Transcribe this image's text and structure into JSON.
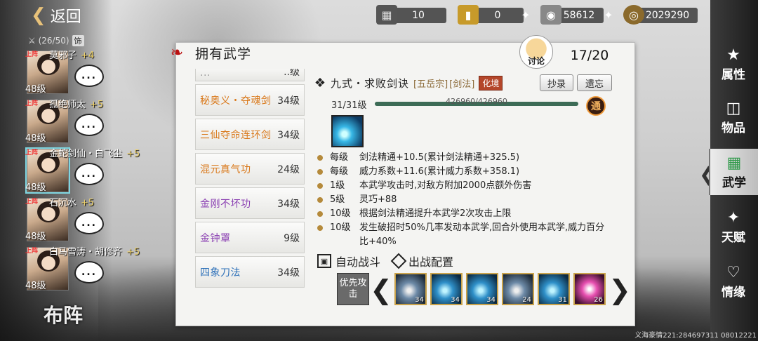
{
  "back_label": "返回",
  "team_count": "(26/50)",
  "team_badge": "饰",
  "heroes": [
    {
      "tag": "上阵",
      "name": "莫邪子",
      "plus": "+4",
      "level": "48级",
      "chat": "..."
    },
    {
      "tag": "上阵",
      "name": "孤绝师太",
      "plus": "+5",
      "level": "48级",
      "chat": "..."
    },
    {
      "tag": "上阵",
      "name": "金蛇剑仙・白飞尘",
      "plus": "+5",
      "level": "48级",
      "chat": "..."
    },
    {
      "tag": "上阵",
      "name": "石沉水",
      "plus": "+5",
      "level": "48级",
      "chat": "..."
    },
    {
      "tag": "上阵",
      "name": "白马雪涛・胡修齐",
      "plus": "+5",
      "level": "48级",
      "chat": "..."
    }
  ],
  "formation_label": "布阵",
  "currency": [
    {
      "icon": "cart-icon",
      "value": "10"
    },
    {
      "icon": "gold-bar-icon",
      "value": "0"
    },
    {
      "icon": "silver-ingot-icon",
      "value": "58612"
    },
    {
      "icon": "coin-icon",
      "value": "2029290"
    }
  ],
  "panel_title": "拥有武学",
  "discuss_label": "讨论",
  "counter": "17/20",
  "skills": [
    {
      "name": "...",
      "level": "..级",
      "color": "gray"
    },
    {
      "name": "秘奥义・夺魂剑",
      "level": "34级",
      "color": "orange"
    },
    {
      "name": "三仙夺命连环剑",
      "level": "34级",
      "color": "orange"
    },
    {
      "name": "混元真气功",
      "level": "24级",
      "color": "orange"
    },
    {
      "name": "金刚不坏功",
      "level": "34级",
      "color": "purple"
    },
    {
      "name": "金钟罩",
      "level": "9级",
      "color": "purple"
    },
    {
      "name": "四象刀法",
      "level": "34级",
      "color": "blue"
    }
  ],
  "detail": {
    "name": "九式・求败剑诀",
    "sect_tag": "[五岳宗]",
    "type_tag": "[剑法]",
    "stage": "化境",
    "copy_label": "抄录",
    "legacy_label": "遗忘",
    "level_text": "31/31级",
    "exp_text": "426960/426960",
    "exp_fraction": 1.0,
    "tong_label": "通",
    "effects": [
      {
        "lv": "每级",
        "text": "剑法精通+10.5(累计剑法精通+325.5)"
      },
      {
        "lv": "每级",
        "text": "威力系数+11.6(累计威力系数+358.1)"
      },
      {
        "lv": "1级",
        "text": "本武学攻击时,对敌方附加2000点额外伤害"
      },
      {
        "lv": "5级",
        "text": "灵巧+88"
      },
      {
        "lv": "10级",
        "text": "根据剑法精通提升本武学2次攻击上限"
      },
      {
        "lv": "10级",
        "text": "发生破招时50%几率发动本武学,回合外使用本武学,威力百分比+40%"
      }
    ],
    "auto_battle_label": "自动战斗",
    "battle_config_label": "出战配置",
    "priority_label": "优先攻击",
    "slots": [
      {
        "value": "34",
        "style": "gray"
      },
      {
        "value": "34",
        "style": "blue"
      },
      {
        "value": "34",
        "style": "blue"
      },
      {
        "value": "24",
        "style": "gray"
      },
      {
        "value": "31",
        "style": "blue"
      },
      {
        "value": "26",
        "style": "pink"
      }
    ]
  },
  "nav": [
    {
      "icon": "pig-icon",
      "label": "属性"
    },
    {
      "icon": "box-icon",
      "label": "物品"
    },
    {
      "icon": "scroll-icon",
      "label": "武学"
    },
    {
      "icon": "branch-icon",
      "label": "天赋"
    },
    {
      "icon": "heart-icon",
      "label": "情缘"
    }
  ],
  "footer": "义海豪情221:284697311 08012221"
}
